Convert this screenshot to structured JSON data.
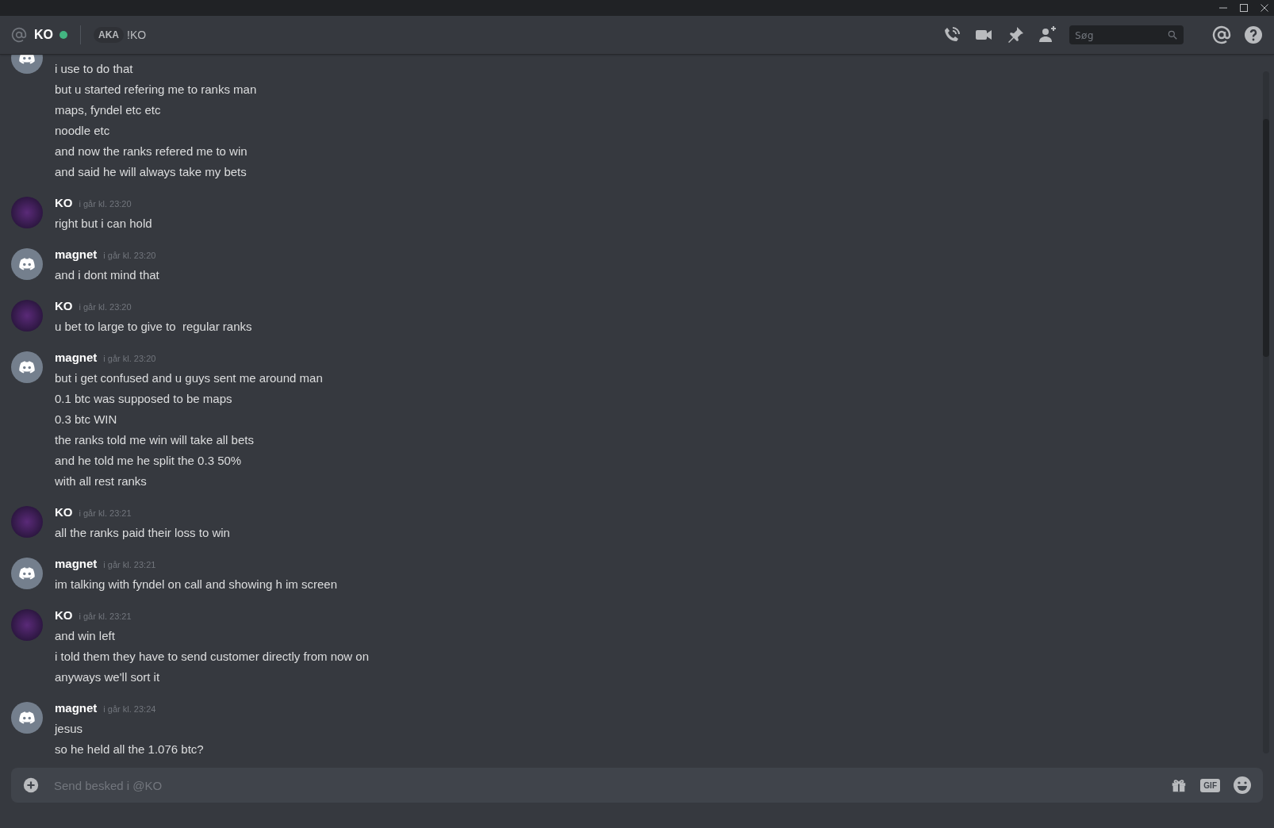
{
  "header": {
    "name": "KO",
    "online": true,
    "aka_label": "AKA",
    "aka_value": "!KO",
    "search": {
      "placeholder": "Søg"
    }
  },
  "messages": [
    {
      "kind": "discord",
      "lines": [
        "i use to do that",
        "but u started refering me to ranks man",
        "maps, fyndel etc etc",
        "noodle etc",
        "and now the ranks refered me to win",
        "and said he will always take my bets"
      ]
    },
    {
      "author": "KO",
      "kind": "image",
      "time": "i går kl. 23:20",
      "lines": [
        "right but i can hold"
      ]
    },
    {
      "author": "magnet",
      "kind": "discord",
      "time": "i går kl. 23:20",
      "lines": [
        "and i dont mind that"
      ]
    },
    {
      "author": "KO",
      "kind": "image",
      "time": "i går kl. 23:20",
      "lines": [
        "u bet to large to give to  regular ranks"
      ]
    },
    {
      "author": "magnet",
      "kind": "discord",
      "time": "i går kl. 23:20",
      "lines": [
        "but i get confused and u guys sent me around man",
        "0.1 btc was supposed to be maps",
        "0.3 btc WIN",
        "the ranks told me win will take all bets",
        "and he told me he split the 0.3 50%",
        "with all rest ranks"
      ]
    },
    {
      "author": "KO",
      "kind": "image",
      "time": "i går kl. 23:21",
      "lines": [
        "all the ranks paid their loss to win"
      ]
    },
    {
      "author": "magnet",
      "kind": "discord",
      "time": "i går kl. 23:21",
      "lines": [
        "im talking with fyndel on call and showing h im screen"
      ]
    },
    {
      "author": "KO",
      "kind": "image",
      "time": "i går kl. 23:21",
      "lines": [
        "and win left",
        "i told them they have to send customer directly from now on",
        "anyways we'll sort it"
      ]
    },
    {
      "author": "magnet",
      "kind": "discord",
      "time": "i går kl. 23:24",
      "lines": [
        "jesus",
        "so he held all the 1.076 btc?"
      ]
    }
  ],
  "composer": {
    "placeholder": "Send besked i @KO",
    "gif_label": "GIF"
  }
}
